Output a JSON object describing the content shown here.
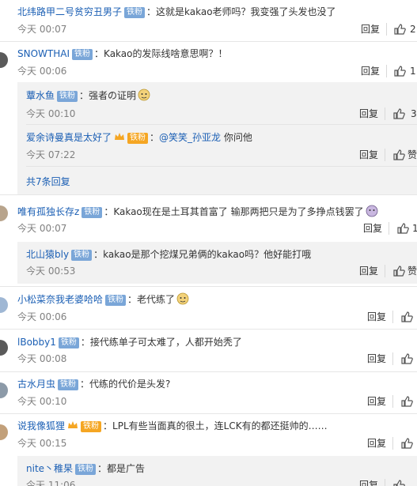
{
  "badge_label": "铁粉",
  "reply_label": "回复",
  "comments": [
    {
      "user": "北纬路甲二号贫穷丑男子",
      "text": "这就是kakao老师吗？我变强了头发也没了",
      "time": "今天 00:07",
      "likes": "2"
    },
    {
      "user": "SNOWTHAI",
      "text": "Kakao的发际线啥意思啊？！",
      "time": "今天 00:06",
      "likes": "1"
    },
    {
      "user": "蕈水鱼",
      "text": "强者の证明",
      "time": "今天 00:10",
      "likes": "3",
      "sub": true
    },
    {
      "user": "爱余诗曼真是太好了",
      "text_prefix": "",
      "mention": "@笑笑_孙亚龙",
      "text": " 你问他",
      "time": "今天 07:22",
      "likes": "赞",
      "sub": true
    },
    {
      "user": "唯有孤独长存z",
      "text": "Kakao现在是土耳其首富了 输那两把只是为了多挣点钱罢了",
      "time": "今天 00:07",
      "likes": "1"
    },
    {
      "user": "北山猿bly",
      "text": "kakao是那个挖煤兄弟俩的kakao吗？他好能打哦",
      "time": "今天 00:53",
      "likes": "赞",
      "sub": true
    },
    {
      "user": "小松菜奈我老婆哈哈",
      "text": "老代练了",
      "time": "今天 00:06",
      "likes": ""
    },
    {
      "user": "lBobby1",
      "text": "接代练单子可太难了，人都开始秃了",
      "time": "今天 00:08",
      "likes": ""
    },
    {
      "user": "古水月虫",
      "text": "代练的代价是头发?",
      "time": "今天 00:10",
      "likes": ""
    },
    {
      "user": "说我像狐狸",
      "text": "LPL有些当面真的很土，连LCK有的都还挺帅的……",
      "time": "今天 00:15",
      "likes": ""
    },
    {
      "user": "nite丶稚杲",
      "text": "都是广告",
      "time": "今天 11:06",
      "likes": "",
      "sub": true
    }
  ],
  "more_replies": "共7条回复",
  "colors": {
    "user_orange": "#eb7350",
    "link_blue": "#1b5fb4",
    "badge_blue": "#7aa6d8",
    "sub_bg": "#f2f2f2"
  }
}
